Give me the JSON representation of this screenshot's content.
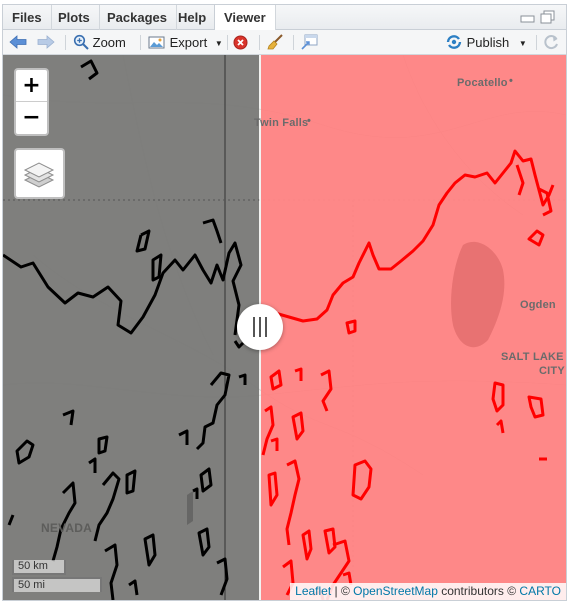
{
  "tabs": [
    {
      "label": "Files",
      "active": false
    },
    {
      "label": "Plots",
      "active": false
    },
    {
      "label": "Packages",
      "active": false
    },
    {
      "label": "Help",
      "active": false
    },
    {
      "label": "Viewer",
      "active": true
    }
  ],
  "toolbar": {
    "zoom_label": "Zoom",
    "export_label": "Export",
    "publish_label": "Publish"
  },
  "map": {
    "zoom_in": "+",
    "zoom_out": "−",
    "scale_km": "50 km",
    "scale_mi": "50 mi",
    "cities": {
      "pocatello": "Pocatello",
      "twin_falls": "Twin Falls",
      "ogden": "Ogden",
      "salt_lake": "SALT LAKE",
      "salt_lake_2": "CITY",
      "nevada": "NEVADA"
    },
    "attribution": {
      "leaflet": "Leaflet",
      "sep": " | © ",
      "osm": "OpenStreetMap",
      "contrib": " contributors © ",
      "carto": "CARTO"
    },
    "colors": {
      "left_overlay": "#7a7a78",
      "right_overlay": "#ff7f7f",
      "left_lines": "#000000",
      "right_lines": "#ff0000"
    }
  }
}
